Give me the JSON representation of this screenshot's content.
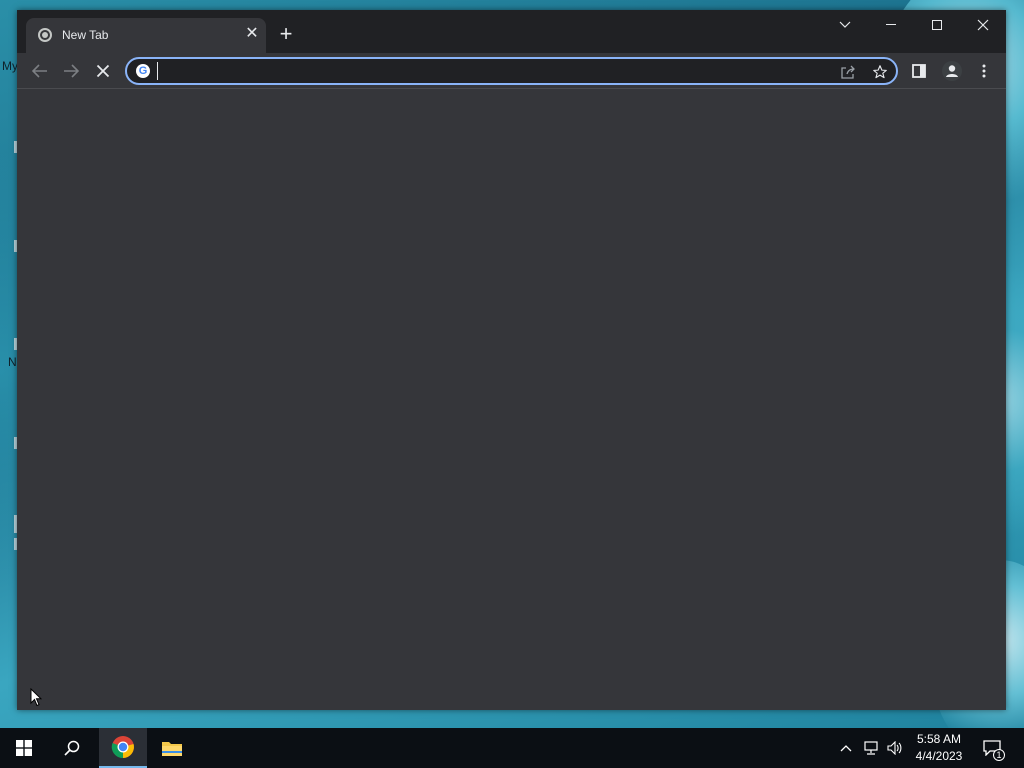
{
  "desktop": {
    "labels": [
      "My",
      "N"
    ]
  },
  "browser": {
    "tab": {
      "title": "New Tab",
      "close_symbol": "✕"
    },
    "new_tab_symbol": "+",
    "window_controls": [
      "chevron-down-icon",
      "minimize-icon",
      "maximize-icon",
      "close-icon"
    ],
    "toolbar": {
      "nav_icons": [
        "back-arrow-icon",
        "forward-arrow-icon",
        "stop-icon"
      ],
      "omnibox": {
        "value": "",
        "placeholder": ""
      },
      "omnibox_logo": "G",
      "omnibox_icons": [
        "share-icon",
        "star-icon"
      ],
      "right_icons": [
        "side-panel-icon",
        "profile-icon",
        "kebab-menu-icon"
      ]
    },
    "colors": {
      "frame": "#202124",
      "surface": "#35363a",
      "focus_ring": "#8ab4f8",
      "text": "#e8eaed"
    }
  },
  "taskbar": {
    "items": [
      "windows-start-icon",
      "search-icon",
      "chrome-icon",
      "file-explorer-icon"
    ],
    "tray_icons": [
      "chevron-up-icon",
      "network-icon",
      "volume-icon",
      "notifications-icon"
    ],
    "time": "5:58 AM",
    "date": "4/4/2023",
    "notification_count": "1"
  }
}
